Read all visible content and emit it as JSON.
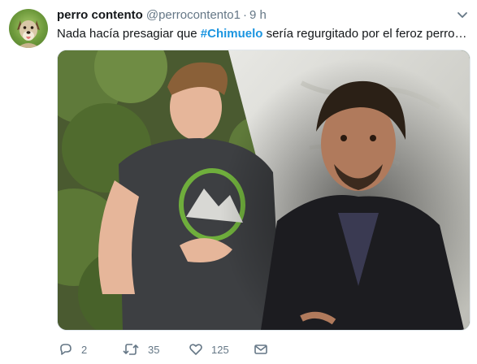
{
  "tweet": {
    "author_name": "perro contento",
    "handle": "@perrocontento1",
    "separator": "·",
    "time": "9 h",
    "text_before": "Nada hacía presagiar que ",
    "hashtag": "#Chimuelo",
    "text_after": " sería regurgitado por el feroz perro…"
  },
  "actions": {
    "replies": "2",
    "retweets": "35",
    "likes": "125"
  },
  "colors": {
    "hashtag": "#1b95e0",
    "secondary_text": "#657786",
    "primary_text": "#14171a"
  },
  "icons": [
    "dog-avatar-icon",
    "chevron-down-icon",
    "reply-icon",
    "retweet-icon",
    "like-icon",
    "direct-message-icon"
  ]
}
